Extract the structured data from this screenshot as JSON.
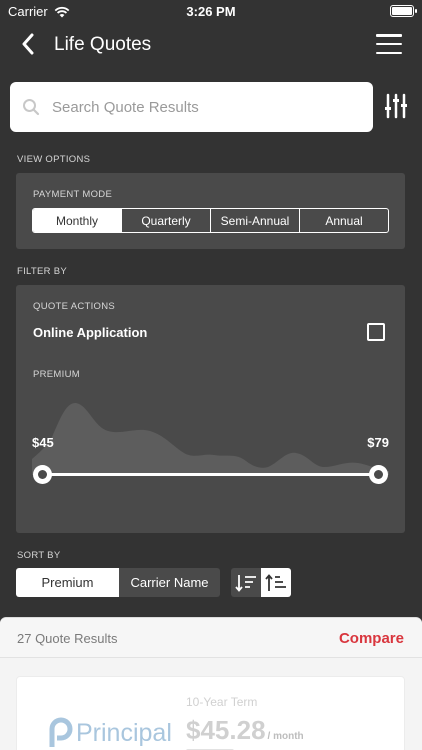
{
  "status_bar": {
    "carrier": "Carrier",
    "time": "3:26 PM"
  },
  "nav": {
    "title": "Life Quotes"
  },
  "search": {
    "placeholder": "Search Quote Results"
  },
  "view_options": {
    "label": "VIEW OPTIONS",
    "payment_mode_label": "PAYMENT MODE",
    "modes": [
      "Monthly",
      "Quarterly",
      "Semi-Annual",
      "Annual"
    ],
    "selected_mode": "Monthly"
  },
  "filter_by": {
    "label": "FILTER BY",
    "quote_actions_label": "QUOTE ACTIONS",
    "online_application_label": "Online Application",
    "online_application_checked": false,
    "premium_label": "PREMIUM",
    "range_min": "$45",
    "range_max": "$79"
  },
  "sort_by": {
    "label": "SORT BY",
    "options": [
      "Premium",
      "Carrier Name"
    ],
    "selected": "Premium",
    "direction": "ascending"
  },
  "results": {
    "count_text": "27 Quote Results",
    "compare_label": "Compare",
    "first_quote": {
      "carrier_logo_text": "Principal",
      "term": "10-Year Term",
      "price": "$45.28",
      "per": "/ month"
    }
  },
  "colors": {
    "background": "#333333",
    "card": "#4a4a4a",
    "accent": "#d9363e",
    "logo": "#a9c6de"
  }
}
